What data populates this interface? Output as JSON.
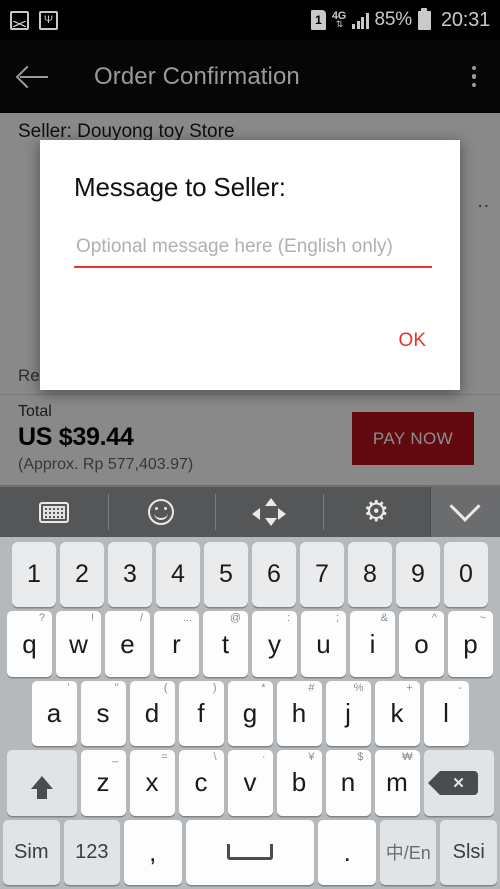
{
  "status_bar": {
    "icons_left": [
      "image-icon",
      "usb-icon"
    ],
    "sim_label": "1",
    "network_type": "4G",
    "battery_percent": "85%",
    "time": "20:31"
  },
  "app_bar": {
    "back_icon": "back-arrow-icon",
    "title": "Order Confirmation",
    "overflow_icon": "kebab-menu-icon"
  },
  "page": {
    "seller_line": "Seller: Douyong toy Store",
    "right_ellipsis": "..",
    "receipt_line": "Re",
    "total_label": "Total",
    "total_amount": "US $39.44",
    "approx_amount": "(Approx. Rp 577,403.97)",
    "pay_now_label": "PAY NOW",
    "pay_now_color": "#b3121c"
  },
  "dialog": {
    "title": "Message to Seller:",
    "input_value": "",
    "input_placeholder": "Optional message here (English only)",
    "underline_color": "#e8322a",
    "ok_label": "OK",
    "ok_color": "#e8322a"
  },
  "keyboard_toolbar": {
    "items": [
      {
        "name": "keyboard-layout-icon"
      },
      {
        "name": "emoji-icon"
      },
      {
        "name": "cursor-arrows-icon"
      },
      {
        "name": "gear-icon",
        "glyph": "⚙"
      }
    ],
    "collapse_icon": "chevron-down-icon"
  },
  "keyboard": {
    "row_numbers": [
      {
        "main": "1"
      },
      {
        "main": "2"
      },
      {
        "main": "3"
      },
      {
        "main": "4"
      },
      {
        "main": "5"
      },
      {
        "main": "6"
      },
      {
        "main": "7"
      },
      {
        "main": "8"
      },
      {
        "main": "9"
      },
      {
        "main": "0"
      }
    ],
    "row_q": [
      {
        "main": "q",
        "sup": "?"
      },
      {
        "main": "w",
        "sup": "!"
      },
      {
        "main": "e",
        "sup": "/"
      },
      {
        "main": "r",
        "sup": "..."
      },
      {
        "main": "t",
        "sup": "@"
      },
      {
        "main": "y",
        "sup": ":"
      },
      {
        "main": "u",
        "sup": ";"
      },
      {
        "main": "i",
        "sup": "&"
      },
      {
        "main": "o",
        "sup": "^"
      },
      {
        "main": "p",
        "sup": "~"
      }
    ],
    "row_a": [
      {
        "main": "a",
        "sup": "'"
      },
      {
        "main": "s",
        "sup": "\""
      },
      {
        "main": "d",
        "sup": "("
      },
      {
        "main": "f",
        "sup": ")"
      },
      {
        "main": "g",
        "sup": "*"
      },
      {
        "main": "h",
        "sup": "#"
      },
      {
        "main": "j",
        "sup": "%"
      },
      {
        "main": "k",
        "sup": "+"
      },
      {
        "main": "l",
        "sup": "-"
      }
    ],
    "row_z": [
      {
        "main": "z",
        "sup": "_"
      },
      {
        "main": "x",
        "sup": "="
      },
      {
        "main": "c",
        "sup": "\\"
      },
      {
        "main": "v",
        "sup": "·"
      },
      {
        "main": "b",
        "sup": "¥"
      },
      {
        "main": "n",
        "sup": "$"
      },
      {
        "main": "m",
        "sup": "₩"
      }
    ],
    "shift_icon": "shift-arrow-icon",
    "backspace_icon": "backspace-icon",
    "row_bottom": {
      "sim": "Sim",
      "numbers": "123",
      "comma": ",",
      "space_icon": "spacebar-icon",
      "period": ".",
      "language": "中/En",
      "slsi": "Slsi"
    }
  }
}
